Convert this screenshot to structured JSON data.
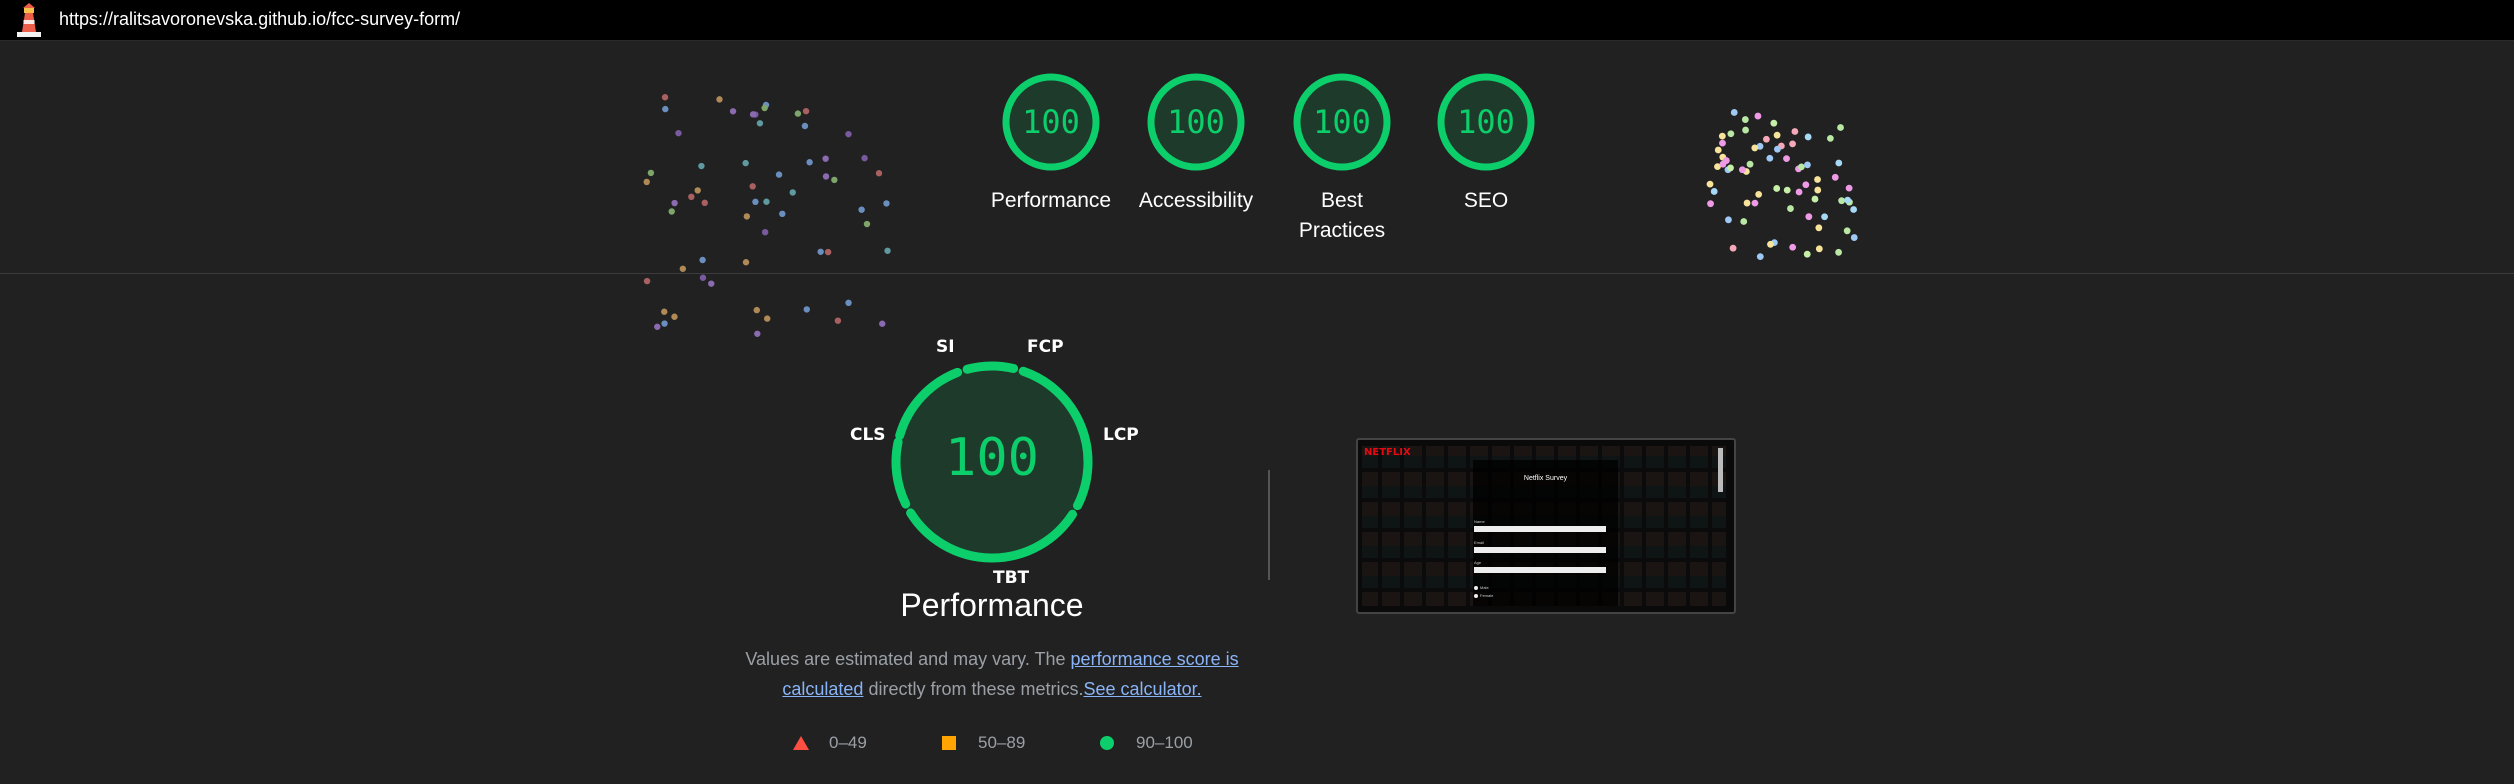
{
  "browser": {
    "url": "https://ralitsavoronevska.github.io/fcc-survey-form/"
  },
  "categories": [
    {
      "label": "Performance",
      "score": "100"
    },
    {
      "label": "Accessibility",
      "score": "100"
    },
    {
      "label": "Best Practices",
      "score": "100"
    },
    {
      "label": "SEO",
      "score": "100"
    }
  ],
  "performance": {
    "score": "100",
    "title": "Performance",
    "metrics": {
      "si": "SI",
      "fcp": "FCP",
      "lcp": "LCP",
      "tbt": "TBT",
      "cls": "CLS"
    },
    "description": {
      "text1": "Values are estimated and may vary. The ",
      "link1": "performance score is calculated",
      "text2": " directly from these metrics.",
      "link2": "See calculator."
    }
  },
  "legend": [
    {
      "range": "0–49",
      "shape": "triangle-icon",
      "color": "#ff4e42"
    },
    {
      "range": "50–89",
      "shape": "square-icon",
      "color": "#ffa400"
    },
    {
      "range": "90–100",
      "shape": "circle-icon",
      "color": "#0cce6b"
    }
  ],
  "screenshot": {
    "brand": "NETFLIX",
    "heading": "Netflix Survey",
    "labels": [
      "Name",
      "Email",
      "Age"
    ],
    "radio_labels": [
      "Male",
      "Female"
    ]
  },
  "colors": {
    "pass": "#0cce6b",
    "background": "#212121",
    "link": "#8ab4f8"
  }
}
